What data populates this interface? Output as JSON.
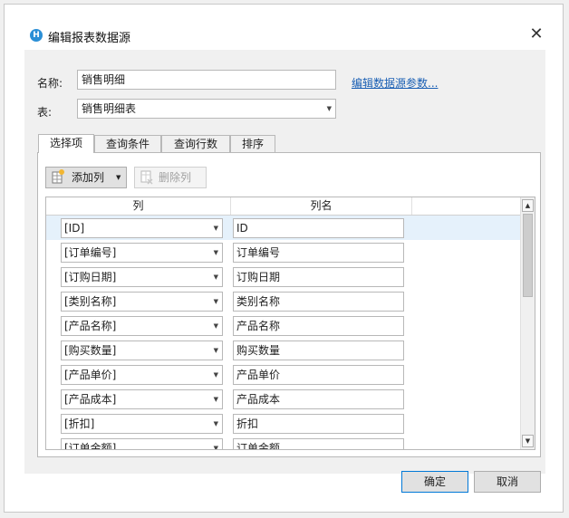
{
  "window": {
    "title": "编辑报表数据源",
    "app_icon": "H",
    "close_glyph": "✕"
  },
  "form": {
    "name_label": "名称:",
    "name_value": "销售明细",
    "table_label": "表:",
    "table_value": "销售明细表",
    "edit_params_link": "编辑数据源参数..."
  },
  "tabs": [
    {
      "label": "选择项",
      "active": true
    },
    {
      "label": "查询条件",
      "active": false
    },
    {
      "label": "查询行数",
      "active": false
    },
    {
      "label": "排序",
      "active": false
    }
  ],
  "toolbar": {
    "add_column_label": "添加列",
    "delete_column_label": "删除列"
  },
  "grid": {
    "headers": [
      "列",
      "列名"
    ],
    "rows": [
      {
        "column": "[ID]",
        "name": "ID"
      },
      {
        "column": "[订单编号]",
        "name": "订单编号"
      },
      {
        "column": "[订购日期]",
        "name": "订购日期"
      },
      {
        "column": "[类别名称]",
        "name": "类别名称"
      },
      {
        "column": "[产品名称]",
        "name": "产品名称"
      },
      {
        "column": "[购买数量]",
        "name": "购买数量"
      },
      {
        "column": "[产品单价]",
        "name": "产品单价"
      },
      {
        "column": "[产品成本]",
        "name": "产品成本"
      },
      {
        "column": "[折扣]",
        "name": "折扣"
      },
      {
        "column": "[订单金额]",
        "name": "订单金额"
      }
    ]
  },
  "buttons": {
    "ok_label": "确定",
    "cancel_label": "取消"
  },
  "colors": {
    "accent": "#2b8fd6",
    "link": "#1a5fb4",
    "selected_row": "#e5f1fb"
  }
}
